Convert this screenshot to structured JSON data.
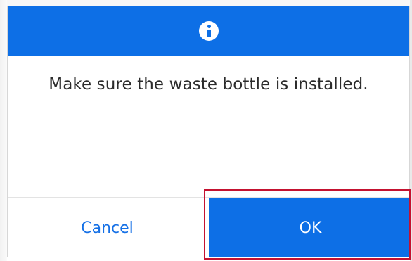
{
  "dialog": {
    "header": {
      "icon": "info-icon",
      "color": "#0d6fe6"
    },
    "message": "Make sure the waste bottle is installed.",
    "buttons": {
      "cancel_label": "Cancel",
      "ok_label": "OK"
    }
  },
  "colors": {
    "accent": "#0d6fe6",
    "highlight": "#c41230"
  }
}
